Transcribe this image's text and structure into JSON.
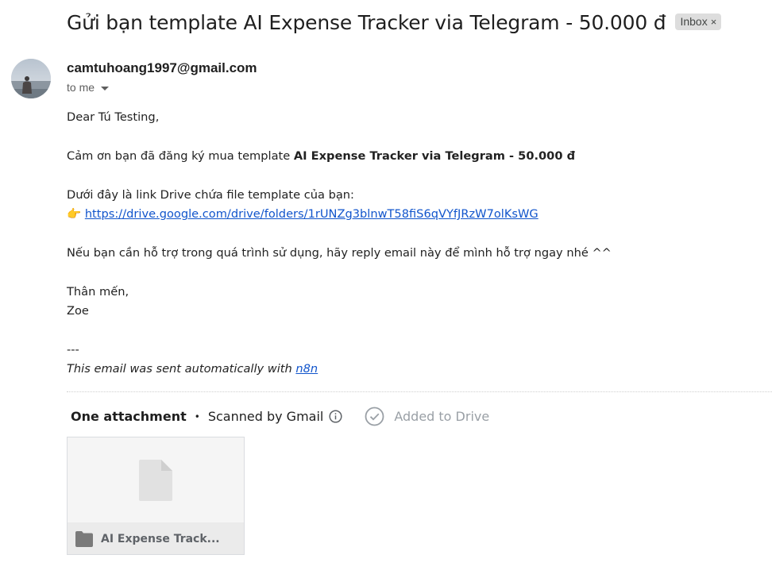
{
  "email": {
    "subject": "Gửi bạn template AI Expense Tracker via Telegram - 50.000 đ",
    "label": "Inbox",
    "label_remove": "×",
    "sender": "camtuhoang1997@gmail.com",
    "recipient_line": "to me",
    "body": {
      "greeting": "Dear Tú Testing,",
      "thanks_prefix": "Cảm ơn bạn đã đăng ký mua template ",
      "thanks_product": "AI Expense Tracker via Telegram - 50.000 đ",
      "drive_intro": "Dưới đây là link Drive chứa file template của bạn:",
      "pointer_emoji": "👉",
      "drive_link": "https://drive.google.com/drive/folders/1rUNZg3blnwT58fiS6qVYfJRzW7olKsWG",
      "support": "Nếu bạn cần hỗ trợ trong quá trình sử dụng, hãy reply email này để mình hỗ trợ ngay nhé ^^",
      "closing": "Thân mến,",
      "signature": "Zoe",
      "separator": "---",
      "footer_prefix": "This email was sent automatically with ",
      "footer_link": "n8n"
    }
  },
  "attachments": {
    "title": "One attachment",
    "bullet": "•",
    "scan_text": "Scanned by Gmail",
    "added_to_drive": "Added to Drive",
    "items": [
      {
        "name": "AI Expense Track..."
      }
    ]
  },
  "colors": {
    "link": "#1155cc",
    "chip_bg": "#dddddd",
    "muted": "#9aa0a6"
  },
  "icons": {
    "label_remove": "close-icon",
    "recipient_toggle": "chevron-down-icon",
    "scan_info": "info-icon",
    "drive_status": "check-circle-icon",
    "file_preview": "file-icon",
    "file_type": "folder-icon"
  }
}
